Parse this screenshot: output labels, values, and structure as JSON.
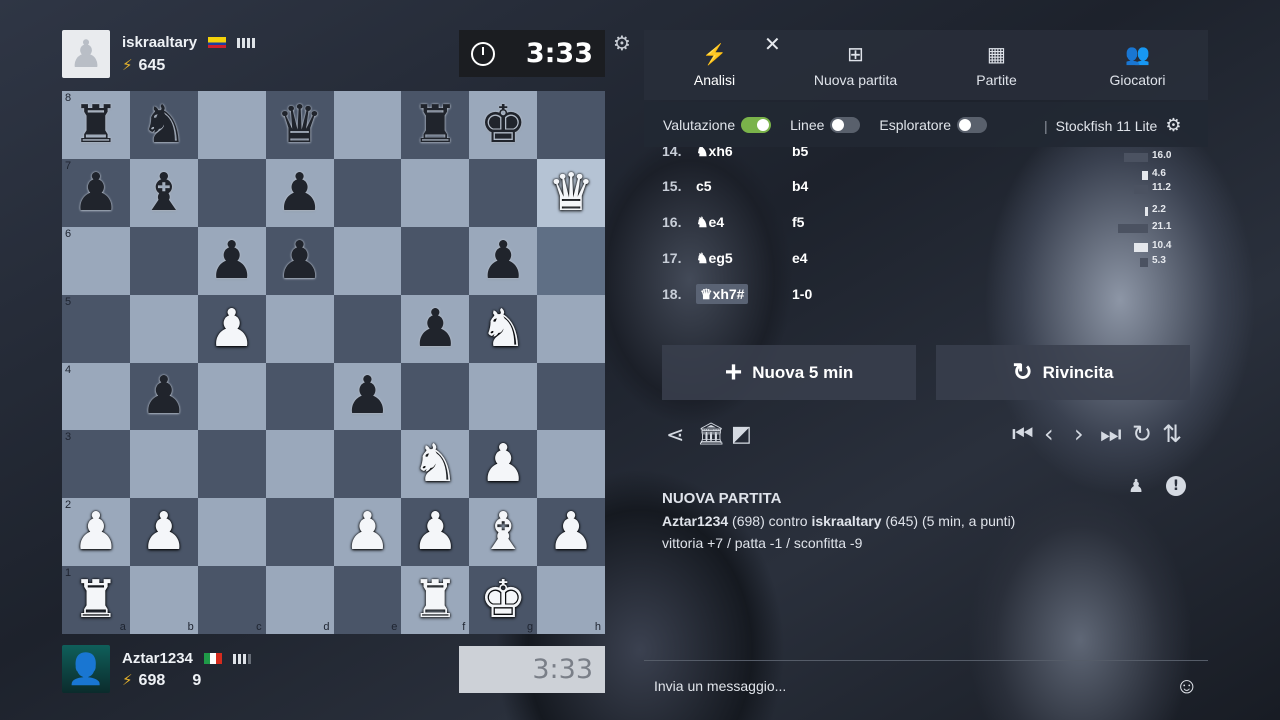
{
  "top_player": {
    "avatar_icon": "white-pawn-avatar",
    "name": "iskraaltary",
    "rating": "645",
    "flag_colors": [
      "#f5d20a",
      "#1b3fa0",
      "#d0202b"
    ]
  },
  "bottom_player": {
    "avatar_icon": "hooded-figure-avatar",
    "name": "Aztar1234",
    "rating": "698",
    "extra": "9",
    "flag_colors": [
      "#1f9a48",
      "#ffffff",
      "#d52b1e"
    ]
  },
  "clocks": {
    "top": "3:33",
    "bottom": "3:33"
  },
  "board": {
    "ranks": [
      "8",
      "7",
      "6",
      "5",
      "4",
      "3",
      "2",
      "1"
    ],
    "files": [
      "a",
      "b",
      "c",
      "d",
      "e",
      "f",
      "g",
      "h"
    ],
    "position": [
      [
        "r",
        "n",
        "",
        "q",
        "",
        "r",
        "k",
        ""
      ],
      [
        "p",
        "b",
        "",
        "p",
        "",
        "",
        "",
        "Q"
      ],
      [
        "",
        "",
        "p",
        "p",
        "",
        "",
        "p",
        ""
      ],
      [
        "",
        "",
        "P",
        "",
        "",
        "p",
        "N",
        ""
      ],
      [
        "",
        "p",
        "",
        "",
        "p",
        "",
        "",
        ""
      ],
      [
        "",
        "",
        "",
        "",
        "",
        "N",
        "P",
        ""
      ],
      [
        "P",
        "P",
        "",
        "",
        "P",
        "P",
        "B",
        "P"
      ],
      [
        "R",
        "",
        "",
        "",
        "",
        "R",
        "K",
        ""
      ]
    ],
    "highlighted": [
      "h7",
      "h6"
    ]
  },
  "tabs": [
    {
      "icon": "lightning-icon",
      "glyph": "⚡",
      "label": "Analisi",
      "active": true
    },
    {
      "icon": "plus-square-icon",
      "glyph": "⊞",
      "label": "Nuova partita"
    },
    {
      "icon": "chessboard-icon",
      "glyph": "▦",
      "label": "Partite"
    },
    {
      "icon": "players-icon",
      "glyph": "👥",
      "label": "Giocatori"
    }
  ],
  "toggles": {
    "valutazione": "Valutazione",
    "linee": "Linee",
    "esploratore": "Esploratore",
    "engine": "Stockfish 11 Lite"
  },
  "moves": [
    {
      "no": "14.",
      "white": "♞xh6",
      "black": "b5"
    },
    {
      "no": "15.",
      "white": "c5",
      "black": "b4"
    },
    {
      "no": "16.",
      "white": "♞e4",
      "black": "f5"
    },
    {
      "no": "17.",
      "white": "♞eg5",
      "black": "e4"
    },
    {
      "no": "18.",
      "white": "♛xh7#",
      "black": "1-0"
    }
  ],
  "eval_values": [
    "16.0",
    "4.6",
    "11.2",
    "2.2",
    "21.1",
    "10.4",
    "5.3"
  ],
  "buttons": {
    "new_game": "Nuova 5 min",
    "rematch": "Rivincita"
  },
  "info": {
    "title": "NUOVA PARTITA",
    "white_player": "Aztar1234",
    "white_rating": "(698)",
    "vs": "contro",
    "black_player": "iskraaltary",
    "black_rating": "(645)",
    "mode": "(5 min, a punti)",
    "points": "vittoria +7 / patta -1 / sconfitta -9"
  },
  "chat": {
    "placeholder": "Invia un messaggio..."
  },
  "colors": {
    "accent_green": "#7ab34a",
    "light_square": "#9aa8bb",
    "dark_square": "#4a5568"
  }
}
